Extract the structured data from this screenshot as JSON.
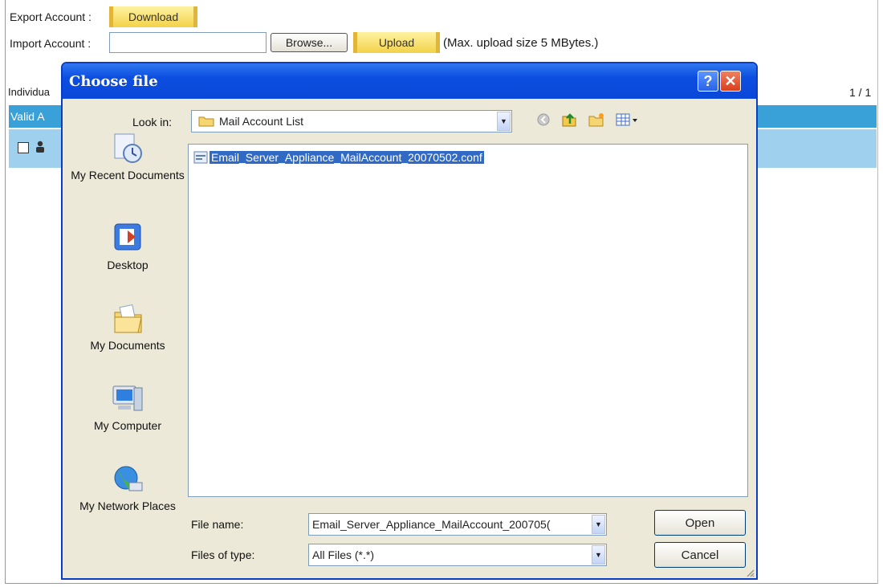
{
  "page": {
    "export_label": "Export Account :",
    "download_button": "Download",
    "import_label": "Import Account :",
    "import_value": "",
    "browse_button": "Browse...",
    "upload_button": "Upload",
    "upload_note": "(Max. upload size 5 MBytes.)",
    "section_label_partial": "Individua",
    "valid_partial": "Valid A",
    "pagination": "1 / 1"
  },
  "dialog": {
    "title": "Choose file",
    "help_glyph": "?",
    "close_glyph": "✕",
    "look_in_label": "Look in:",
    "look_in_value": "Mail Account List",
    "places": [
      {
        "label": "My Recent Documents",
        "icon": "recent-documents-icon"
      },
      {
        "label": "Desktop",
        "icon": "desktop-icon"
      },
      {
        "label": "My Documents",
        "icon": "my-documents-icon"
      },
      {
        "label": "My Computer",
        "icon": "my-computer-icon"
      },
      {
        "label": "My Network Places",
        "icon": "network-places-icon"
      }
    ],
    "files": [
      {
        "name": "Email_Server_Appliance_MailAccount_20070502.conf",
        "selected": true
      }
    ],
    "file_name_label": "File name:",
    "file_name_value": "Email_Server_Appliance_MailAccount_200705(",
    "file_type_label": "Files of type:",
    "file_type_value": "All Files (*.*)",
    "open_button": "Open",
    "cancel_button": "Cancel"
  },
  "colors": {
    "title_bar": "#0a47d8",
    "dialog_bg": "#ece9d8",
    "selection": "#316ac5",
    "header_bar": "#3aa0d8"
  }
}
